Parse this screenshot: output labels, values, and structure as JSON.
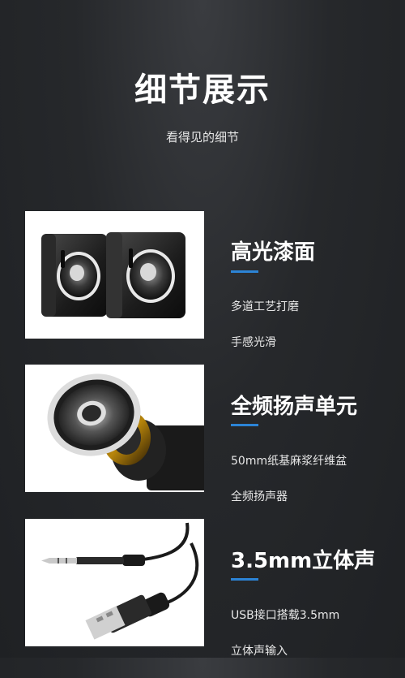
{
  "header": {
    "title": "细节展示",
    "subtitle": "看得见的细节"
  },
  "features": [
    {
      "title": "高光漆面",
      "desc_line1": "多道工艺打磨",
      "desc_line2": "手感光滑"
    },
    {
      "title": "全频扬声单元",
      "desc_line1": "50mm纸基麻浆纤维盆",
      "desc_line2": "全频扬声器"
    },
    {
      "title": "3.5mm立体声",
      "desc_line1": "USB接口搭载3.5mm",
      "desc_line2": "立体声输入"
    }
  ],
  "colors": {
    "accent": "#2c84d6",
    "background": "#26282b"
  }
}
